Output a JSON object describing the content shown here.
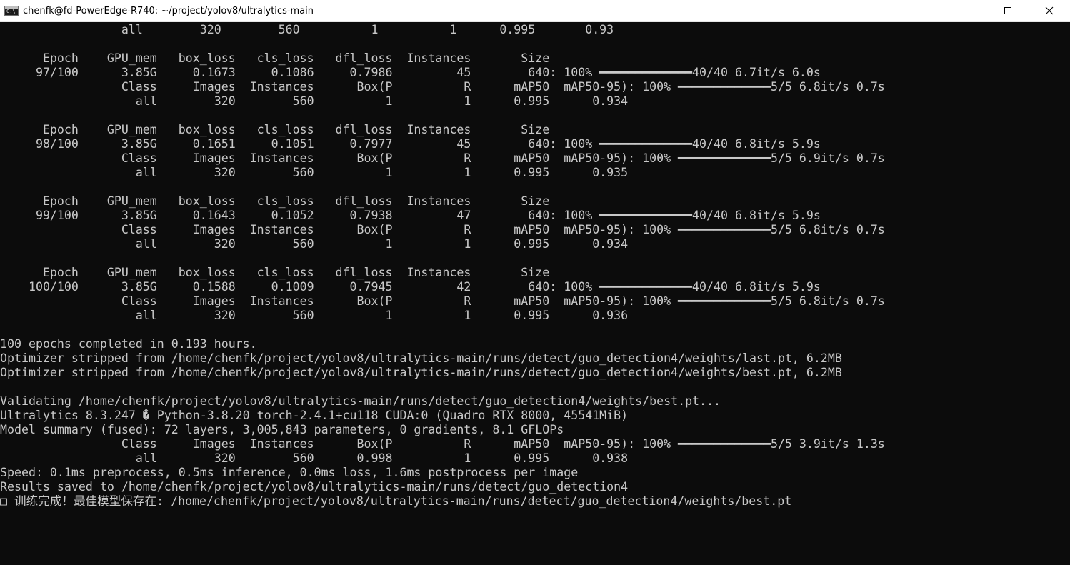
{
  "window": {
    "title": "chenfk@fd-PowerEdge-R740: ~/project/yolov8/ultralytics-main",
    "icon_label": "C:\\",
    "controls": [
      "minimize",
      "maximize",
      "close"
    ]
  },
  "console": {
    "text_color": "#c8c8c8",
    "background": "#0c0c0c",
    "lines": [
      "                 all        320        560          1          1      0.995       0.93",
      "",
      "      Epoch    GPU_mem   box_loss   cls_loss   dfl_loss  Instances       Size",
      "     97/100      3.85G     0.1673     0.1086     0.7986         45        640: 100% ━━━━━━━━━━━━━40/40 6.7it/s 6.0s",
      "                 Class     Images  Instances      Box(P          R      mAP50  mAP50-95): 100% ━━━━━━━━━━━━━5/5 6.8it/s 0.7s",
      "                   all        320        560          1          1      0.995      0.934",
      "",
      "      Epoch    GPU_mem   box_loss   cls_loss   dfl_loss  Instances       Size",
      "     98/100      3.85G     0.1651     0.1051     0.7977         45        640: 100% ━━━━━━━━━━━━━40/40 6.8it/s 5.9s",
      "                 Class     Images  Instances      Box(P          R      mAP50  mAP50-95): 100% ━━━━━━━━━━━━━5/5 6.9it/s 0.7s",
      "                   all        320        560          1          1      0.995      0.935",
      "",
      "      Epoch    GPU_mem   box_loss   cls_loss   dfl_loss  Instances       Size",
      "     99/100      3.85G     0.1643     0.1052     0.7938         47        640: 100% ━━━━━━━━━━━━━40/40 6.8it/s 5.9s",
      "                 Class     Images  Instances      Box(P          R      mAP50  mAP50-95): 100% ━━━━━━━━━━━━━5/5 6.8it/s 0.7s",
      "                   all        320        560          1          1      0.995      0.934",
      "",
      "      Epoch    GPU_mem   box_loss   cls_loss   dfl_loss  Instances       Size",
      "    100/100      3.85G     0.1588     0.1009     0.7945         42        640: 100% ━━━━━━━━━━━━━40/40 6.8it/s 5.9s",
      "                 Class     Images  Instances      Box(P          R      mAP50  mAP50-95): 100% ━━━━━━━━━━━━━5/5 6.8it/s 0.7s",
      "                   all        320        560          1          1      0.995      0.936",
      "",
      "100 epochs completed in 0.193 hours.",
      "Optimizer stripped from /home/chenfk/project/yolov8/ultralytics-main/runs/detect/guo_detection4/weights/last.pt, 6.2MB",
      "Optimizer stripped from /home/chenfk/project/yolov8/ultralytics-main/runs/detect/guo_detection4/weights/best.pt, 6.2MB",
      "",
      "Validating /home/chenfk/project/yolov8/ultralytics-main/runs/detect/guo_detection4/weights/best.pt...",
      "Ultralytics 8.3.247 � Python-3.8.20 torch-2.4.1+cu118 CUDA:0 (Quadro RTX 8000, 45541MiB)",
      "Model summary (fused): 72 layers, 3,005,843 parameters, 0 gradients, 8.1 GFLOPs",
      "                 Class     Images  Instances      Box(P          R      mAP50  mAP50-95): 100% ━━━━━━━━━━━━━5/5 3.9it/s 1.3s",
      "                   all        320        560      0.998          1      0.995      0.938",
      "Speed: 0.1ms preprocess, 0.5ms inference, 0.0ms loss, 1.6ms postprocess per image",
      "Results saved to /home/chenfk/project/yolov8/ultralytics-main/runs/detect/guo_detection4",
      "□ 训练完成！最佳模型保存在: /home/chenfk/project/yolov8/ultralytics-main/runs/detect/guo_detection4/weights/best.pt"
    ]
  }
}
